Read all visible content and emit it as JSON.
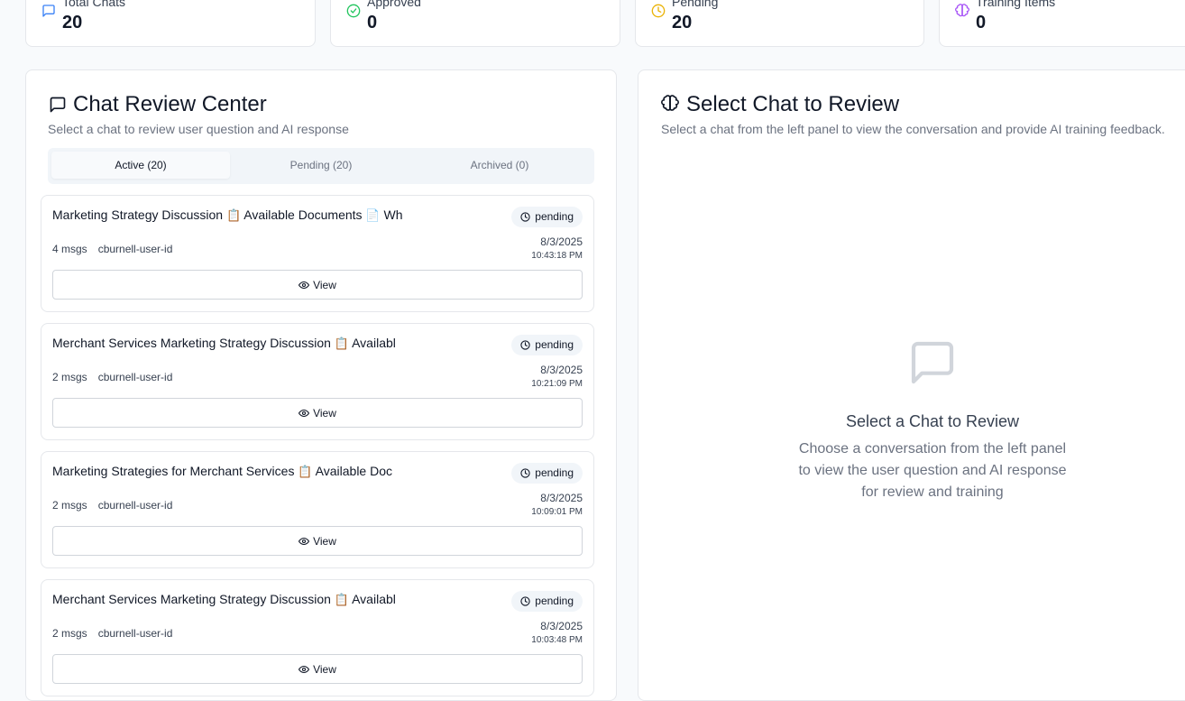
{
  "stats": [
    {
      "label": "Total Chats",
      "value": "20",
      "icon": "message-square-icon",
      "color": "#3b82f6"
    },
    {
      "label": "Approved",
      "value": "0",
      "icon": "check-circle-icon",
      "color": "#22c55e"
    },
    {
      "label": "Pending",
      "value": "20",
      "icon": "clock-icon",
      "color": "#eab308"
    },
    {
      "label": "Training Items",
      "value": "0",
      "icon": "brain-icon",
      "color": "#a855f7"
    }
  ],
  "review_center": {
    "title": "Chat Review Center",
    "subtitle": "Select a chat to review user question and AI response",
    "tabs": [
      {
        "label": "Active (20)",
        "active": true
      },
      {
        "label": "Pending (20)",
        "active": false
      },
      {
        "label": "Archived (0)",
        "active": false
      }
    ],
    "chats": [
      {
        "title_a": "Marketing Strategy Discussion ",
        "doc1": "📋",
        "title_b": " Available Documents ",
        "doc2": "📄",
        "title_c": " Wh",
        "status": "pending",
        "msgs": "4 msgs",
        "user": "cburnell-user-id",
        "date": "8/3/2025",
        "time": "10:43:18 PM",
        "action": "View"
      },
      {
        "title_a": "Merchant Services Marketing Strategy Discussion ",
        "doc1": "📋",
        "title_b": " Availabl",
        "doc2": "",
        "title_c": "",
        "status": "pending",
        "msgs": "2 msgs",
        "user": "cburnell-user-id",
        "date": "8/3/2025",
        "time": "10:21:09 PM",
        "action": "View"
      },
      {
        "title_a": "Marketing Strategies for Merchant Services ",
        "doc1": "📋",
        "title_b": " Available Doc",
        "doc2": "",
        "title_c": "",
        "status": "pending",
        "msgs": "2 msgs",
        "user": "cburnell-user-id",
        "date": "8/3/2025",
        "time": "10:09:01 PM",
        "action": "View"
      },
      {
        "title_a": "Merchant Services Marketing Strategy Discussion ",
        "doc1": "📋",
        "title_b": " Availabl",
        "doc2": "",
        "title_c": "",
        "status": "pending",
        "msgs": "2 msgs",
        "user": "cburnell-user-id",
        "date": "8/3/2025",
        "time": "10:03:48 PM",
        "action": "View"
      }
    ]
  },
  "detail": {
    "title": "Select Chat to Review",
    "subtitle": "Select a chat from the left panel to view the conversation and provide AI training feedback.",
    "empty_title": "Select a Chat to Review",
    "empty_desc": "Choose a conversation from the left panel to view the user question and AI response for review and training"
  }
}
